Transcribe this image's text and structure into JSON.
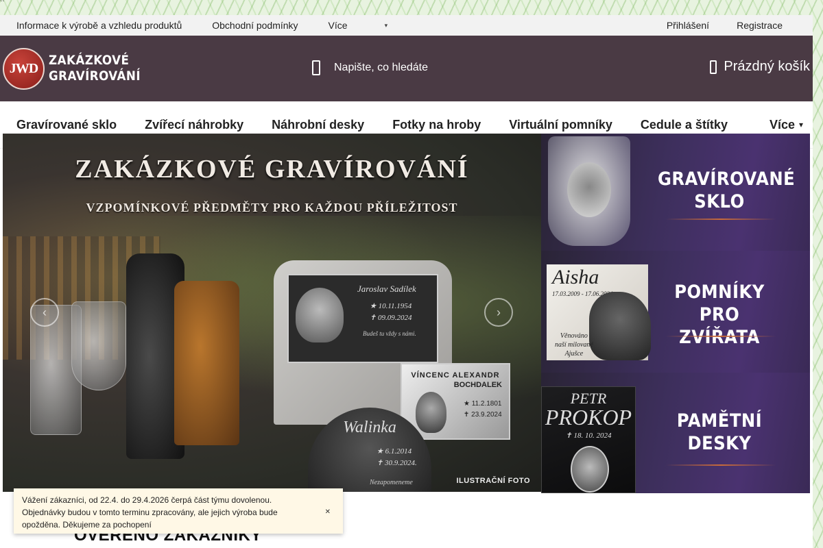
{
  "topbar": {
    "links": [
      "Informace k výrobě a vzhledu produktů",
      "Obchodní podmínky"
    ],
    "more_label": "Více",
    "login": "Přihlášení",
    "register": "Registrace"
  },
  "header": {
    "logo_mark": "JWD",
    "logo_line1": "ZAKÁZKOVÉ",
    "logo_line2": "GRAVÍROVÁNÍ",
    "search_placeholder": "Napište, co hledáte",
    "cart_label": "Prázdný košík"
  },
  "nav": {
    "items": [
      "Gravírované sklo",
      "Zvířecí náhrobky",
      "Náhrobní desky",
      "Fotky na hroby",
      "Virtuální pomníky",
      "Cedule a štítky"
    ],
    "more_label": "Více"
  },
  "banner": {
    "title": "ZAKÁZKOVÉ GRAVÍROVÁNÍ",
    "subtitle": "VZPOMÍNKOVÉ PŘEDMĚTY PRO KAŽDOU PŘÍLEŽITOST",
    "slab_name": "Jaroslav Sadílek",
    "slab_born": "10.11.1954",
    "slab_died": "09.09.2024",
    "slab_quote": "Budeš tu vždy s námi.",
    "plaque_name1": "VÍNCENC ALEXANDR",
    "plaque_name2": "BOCHDALEK",
    "plaque_born": "11.2.1801",
    "plaque_died": "23.9.2024",
    "stone_name": "Walinka",
    "stone_born": "6.1.2014",
    "stone_died": "30.9.2024.",
    "stone_quote": "Nezapomeneme",
    "illustration_label": "ILUSTRAČNÍ FOTO"
  },
  "tiles": [
    {
      "line1": "GRAVÍROVANÉ",
      "line2": "SKLO"
    },
    {
      "line1": "POMNÍKY",
      "line2": "PRO ZVÍŘATA",
      "pet_name": "Aisha",
      "pet_dates": "17.03.2009 - 17.06.2024",
      "pet_text1": "Věnováno",
      "pet_text2": "naší milované",
      "pet_text3": "Ajušce"
    },
    {
      "line1": "PAMĚTNÍ",
      "line2": "DESKY",
      "name1": "PETR",
      "name2": "PROKOP",
      "date": "18. 10. 2024"
    }
  ],
  "notice": {
    "text": "Vážení zákazníci, od 22.4. do 29.4.2026 čerpá část týmu dovolenou. Objednávky budou v tomto terminu zpracovány, ale jejich výroba bude opožděna. Děkujeme za pochopení"
  },
  "section_heading": "OVĚŘENO ZÁKAZNÍKY",
  "stray_mark": "``"
}
